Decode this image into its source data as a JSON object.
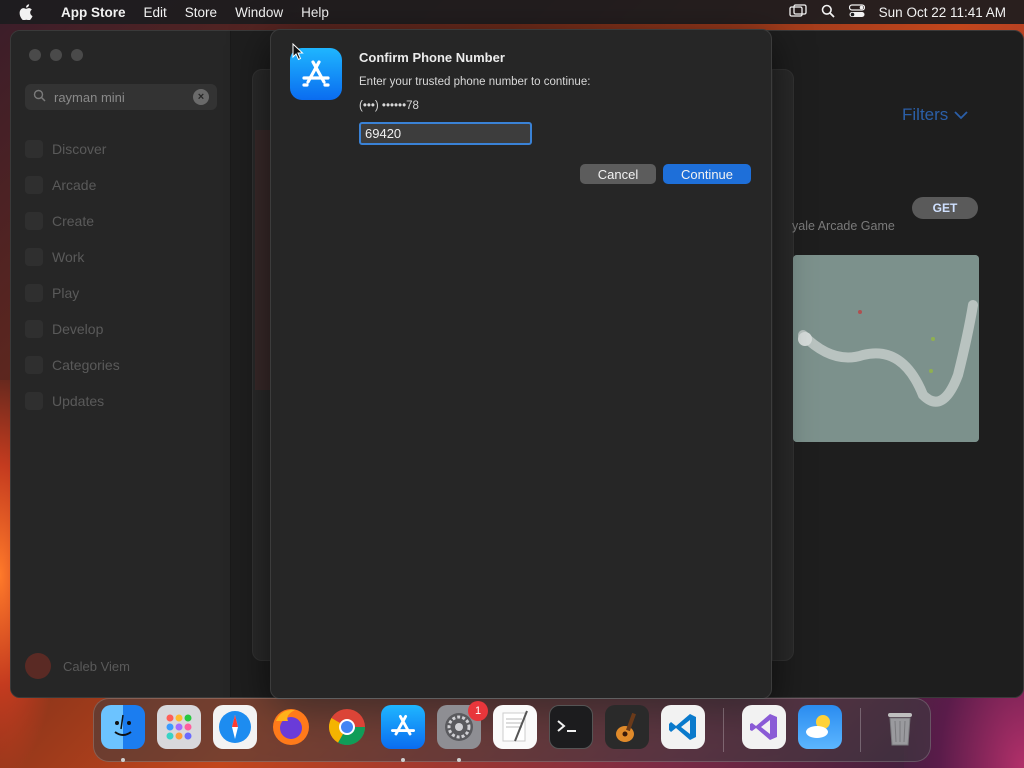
{
  "menubar": {
    "app_name": "App Store",
    "menus": [
      "Edit",
      "Store",
      "Window",
      "Help"
    ],
    "clock": "Sun Oct 22  11:41 AM"
  },
  "sidebar": {
    "search": {
      "value": "rayman mini"
    },
    "items": [
      {
        "label": "Discover"
      },
      {
        "label": "Arcade"
      },
      {
        "label": "Create"
      },
      {
        "label": "Work"
      },
      {
        "label": "Play"
      },
      {
        "label": "Develop"
      },
      {
        "label": "Categories"
      },
      {
        "label": "Updates"
      }
    ],
    "user_name": "Caleb Viem"
  },
  "content": {
    "filters_label": "Filters",
    "get_label": "GET",
    "subtitle": "yale Arcade Game"
  },
  "dialog": {
    "title": "Confirm Phone Number",
    "prompt": "Enter your trusted phone number to continue:",
    "masked_number": "(•••) ••••••78",
    "input_value": "69420",
    "cancel_label": "Cancel",
    "continue_label": "Continue"
  },
  "dock": {
    "items": [
      "Finder",
      "Launchpad",
      "Safari",
      "Firefox",
      "Chrome",
      "App Store",
      "System Settings",
      "TextEdit",
      "Terminal",
      "GarageBand",
      "Visual Studio Code",
      "Visual Studio",
      "Weather",
      "Trash"
    ],
    "settings_badge": "1"
  },
  "colors": {
    "accent": "#1e6fd9",
    "focus_ring": "#3a82d6",
    "badge": "#e8363b"
  }
}
